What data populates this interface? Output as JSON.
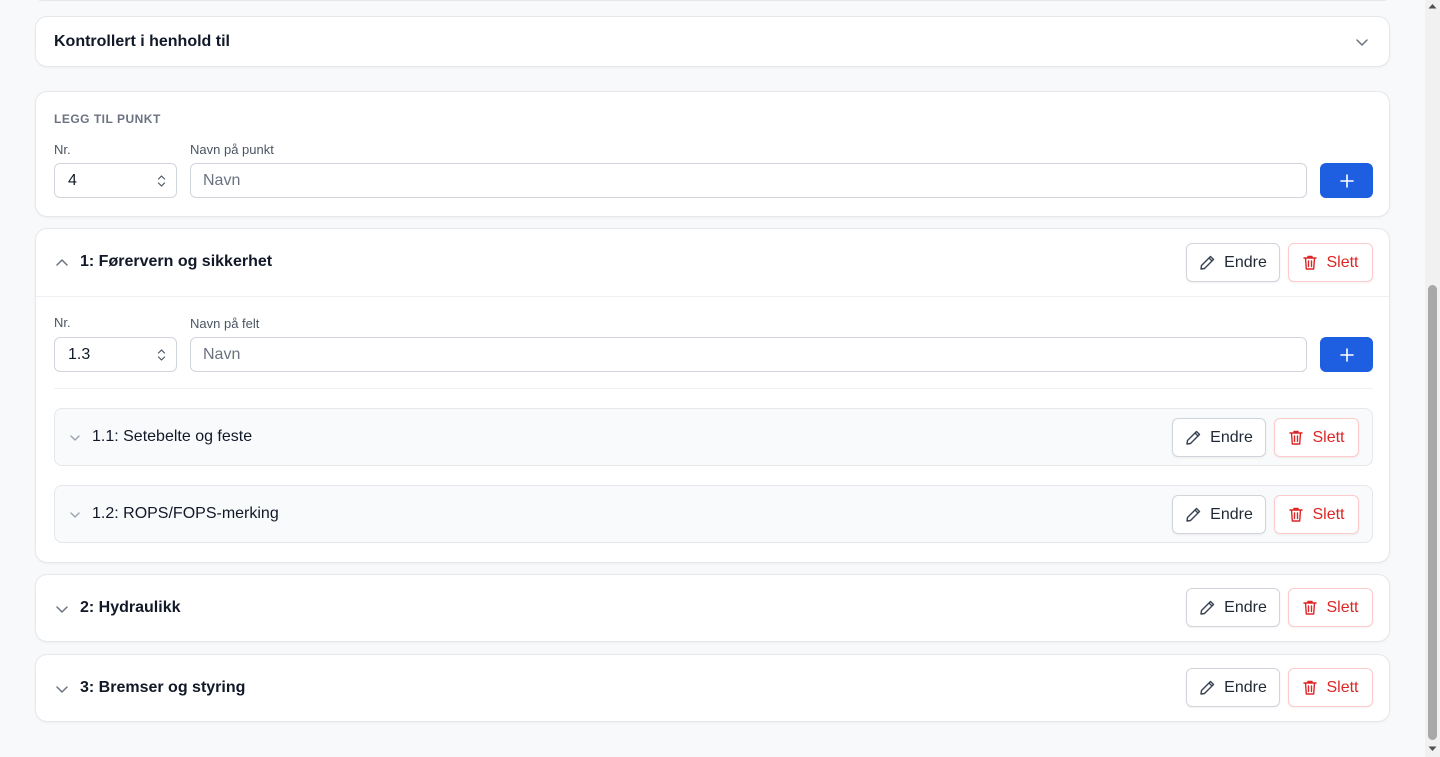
{
  "controlled_card": {
    "title": "Kontrollert i henhold til"
  },
  "add_point": {
    "section_label": "LEGG TIL PUNKT",
    "nr_label": "Nr.",
    "nr_value": "4",
    "name_label": "Navn på punkt",
    "name_placeholder": "Navn"
  },
  "sections": [
    {
      "title": "1: Førervern og sikkerhet",
      "expanded": true,
      "add_field": {
        "nr_label": "Nr.",
        "nr_value": "1.3",
        "name_label": "Navn på felt",
        "name_placeholder": "Navn"
      },
      "fields": [
        {
          "title": "1.1: Setebelte og feste"
        },
        {
          "title": "1.2: ROPS/FOPS-merking"
        }
      ]
    },
    {
      "title": "2: Hydraulikk",
      "expanded": false
    },
    {
      "title": "3: Bremser og styring",
      "expanded": false
    }
  ],
  "buttons": {
    "edit_label": "Endre",
    "delete_label": "Slett"
  },
  "colors": {
    "primary": "#1d5fe0",
    "danger": "#dc2626"
  }
}
